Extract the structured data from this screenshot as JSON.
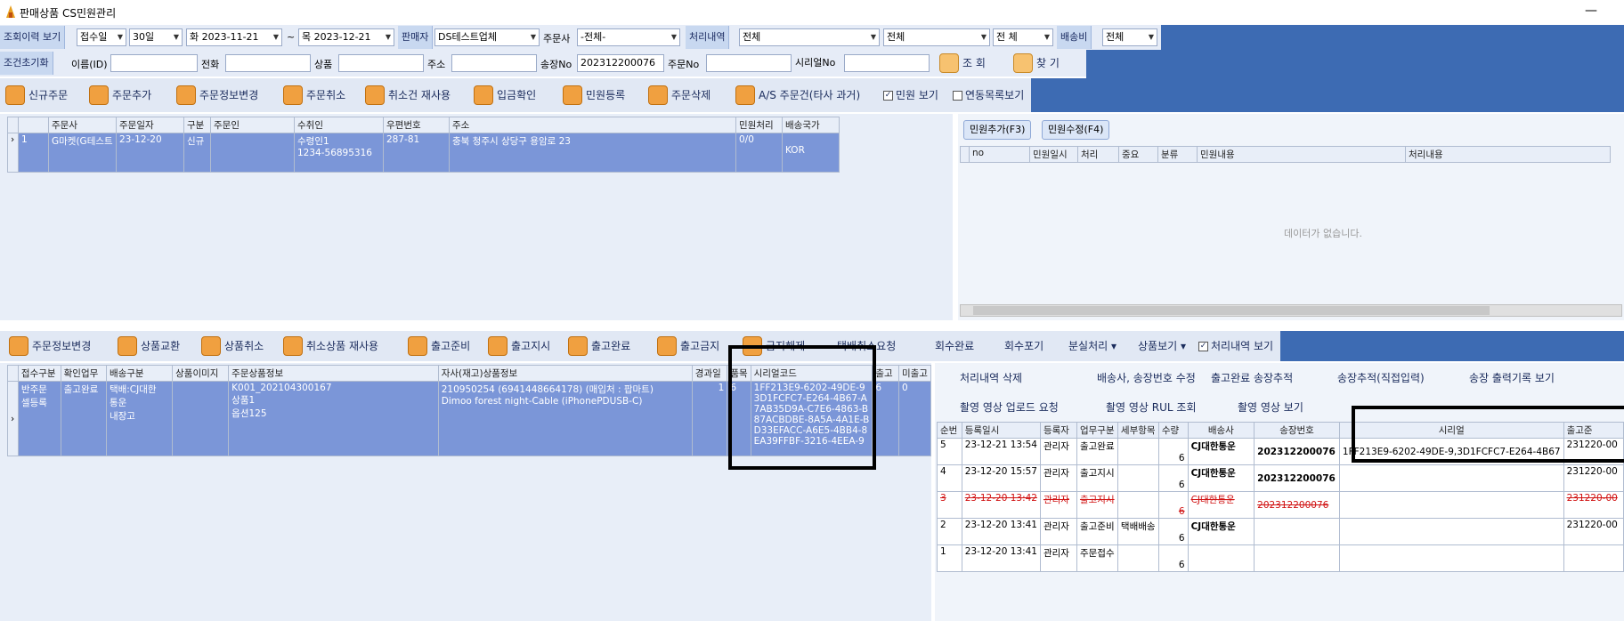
{
  "window": {
    "title": "판매상품 CS민원관리",
    "minimize": "—"
  },
  "filters": {
    "history_label": "조회이력 보기",
    "date_type": "접수일",
    "period": "30일",
    "date_from": "화 2023-11-21",
    "tilde": "~",
    "date_to": "목 2023-12-21",
    "seller_label": "판매자",
    "seller_value": "DS테스트업체",
    "orderer_label": "주문사",
    "orderer_value": "-전체-",
    "process_label": "처리내역",
    "process_value1": "전체",
    "process_value2": "전체",
    "process_value3": "전     체",
    "shipping_label": "배송비",
    "shipping_value": "전체"
  },
  "search": {
    "reset_label": "조건초기화",
    "name_label": "이름(ID)",
    "phone_label": "전화",
    "product_label": "상품",
    "address_label": "주소",
    "invoice_label": "송장No",
    "invoice_value": "202312200076",
    "order_label": "주문No",
    "serial_label": "시리얼No",
    "query_button": "조  회",
    "find_button": "찾  기"
  },
  "toolbar": {
    "items": [
      "신규주문",
      "주문추가",
      "주문정보변경",
      "주문취소",
      "취소건 재사용",
      "입금확인",
      "민원등록",
      "주문삭제",
      "A/S 주문건(타사 과거)"
    ],
    "check_complaint": "민원 보기",
    "check_linked": "연동목록보기"
  },
  "orders": {
    "headers": [
      "주문사",
      "주문일자",
      "구분",
      "주문인",
      "수취인",
      "우편번호",
      "주소",
      "민원처리",
      "배송국가"
    ],
    "row": {
      "num": "1",
      "orderer": "G마켓(G테스트",
      "date": "23-12-20",
      "type": "신규",
      "buyer": "",
      "recipient": "수령인1",
      "recipient_phone": "1234-56895316",
      "zip": "287-81",
      "address": "충북 청주시 상당구 용암로 23",
      "complaint": "0/0",
      "country": "KOR"
    }
  },
  "complaints": {
    "add_button": "민원추가(F3)",
    "edit_button": "민원수정(F4)",
    "headers": [
      "no",
      "민원일시",
      "처리",
      "중요",
      "분류",
      "민원내용",
      "처리내용"
    ],
    "empty": "데이터가 없습니다."
  },
  "toolbar2": {
    "items": [
      "주문정보변경",
      "상품교환",
      "상품취소",
      "취소상품 재사용",
      "출고준비",
      "출고지시",
      "출고완료",
      "출고금지",
      "금지해제"
    ],
    "plain_items": [
      "택배취소요청",
      "회수완료",
      "회수포기"
    ],
    "split_menu": "분실처리 ▾",
    "product_view": "상품보기 ▾",
    "check_history": "처리내역 보기"
  },
  "products": {
    "headers": [
      "접수구분",
      "확인업무",
      "배송구분",
      "상품이미지",
      "주문상품정보",
      "자사(재고)상품정보",
      "경과일",
      "품목",
      "시리얼코드",
      "출고",
      "미출고"
    ],
    "row": {
      "recv": [
        "반주문",
        "셀등록"
      ],
      "confirm": "출고완료",
      "ship": [
        "택배:CJ대한",
        "통운",
        "내장고"
      ],
      "image": "",
      "order_info": [
        "K001_202104300167",
        "상품1",
        "옵션125"
      ],
      "own_info": [
        "210950254 (6941448664178) (매입처 : 팝마트)",
        "Dimoo forest night-Cable (iPhonePDUSB-C)"
      ],
      "days": "1",
      "items": "6",
      "serials": [
        "1FF213E9-6202-49DE-9",
        "3D1FCFC7-E264-4B67-A",
        "7AB35D9A-C7E6-4863-B",
        "87ACBDBE-8A5A-4A1E-B",
        "D33EFACC-A6E5-4BB4-8",
        "EA39FFBF-3216-4EEA-9"
      ],
      "out": "6",
      "not_out": "0"
    }
  },
  "history": {
    "buttons_row1": [
      "처리내역 삭제",
      "배송사, 송장번호 수정",
      "출고완료 송장추적",
      "송장추적(직접입력)",
      "송장 출력기록 보기"
    ],
    "buttons_row2": [
      "촬영 영상 업로드 요청",
      "촬영 영상 RUL 조회",
      "촬영 영상 보기"
    ],
    "headers": [
      "순번",
      "등록일시",
      "등록자",
      "업무구분",
      "세부항목",
      "수량",
      "배송사",
      "송장번호",
      "시리얼",
      "출고준"
    ],
    "rows": [
      {
        "no": "5",
        "date": "23-12-21 13:54",
        "user": "관리자",
        "task": "출고완료",
        "detail": "",
        "qty": "6",
        "carrier": "CJ대한통운",
        "invoice": "202312200076",
        "serial": "1FF213E9-6202-49DE-9,3D1FCFC7-E264-4B67",
        "out": "231220-00"
      },
      {
        "no": "4",
        "date": "23-12-20 15:57",
        "user": "관리자",
        "task": "출고지시",
        "detail": "",
        "qty": "6",
        "carrier": "CJ대한통운",
        "invoice": "202312200076",
        "serial": "",
        "out": "231220-00"
      },
      {
        "no": "3",
        "date": "23-12-20 13:42",
        "user": "관리자",
        "task": "출고지시",
        "detail": "",
        "qty": "6",
        "carrier": "CJ대한통운",
        "invoice": "202312200076",
        "serial": "",
        "out": "231220-00"
      },
      {
        "no": "2",
        "date": "23-12-20 13:41",
        "user": "관리자",
        "task": "출고준비",
        "detail": "택배배송",
        "qty": "6",
        "carrier": "CJ대한통운",
        "invoice": "",
        "serial": "",
        "out": "231220-00"
      },
      {
        "no": "1",
        "date": "23-12-20 13:41",
        "user": "관리자",
        "task": "주문접수",
        "detail": "",
        "qty": "6",
        "carrier": "",
        "invoice": "",
        "serial": "",
        "out": ""
      }
    ]
  }
}
